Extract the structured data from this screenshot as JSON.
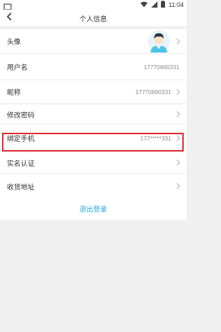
{
  "status_bar": {
    "time": "11:04",
    "icons": [
      "wifi-icon",
      "signal-icon",
      "battery-icon"
    ]
  },
  "header": {
    "title": "个人信息",
    "back_icon": "back-arrow-icon"
  },
  "rows": {
    "avatar": {
      "label": "头像"
    },
    "username": {
      "label": "用户名",
      "value": "17770890331"
    },
    "nickname": {
      "label": "昵称",
      "value": "17770890331"
    },
    "change_password": {
      "label": "修改密码"
    },
    "bind_phone": {
      "label": "绑定手机",
      "value": "177*****331"
    },
    "real_name": {
      "label": "实名认证"
    },
    "address": {
      "label": "收货地址"
    }
  },
  "logout": {
    "label": "退出登录"
  },
  "colors": {
    "accent": "#29a8e0",
    "highlight": "#e0232a",
    "background": "#f0f0f0"
  }
}
